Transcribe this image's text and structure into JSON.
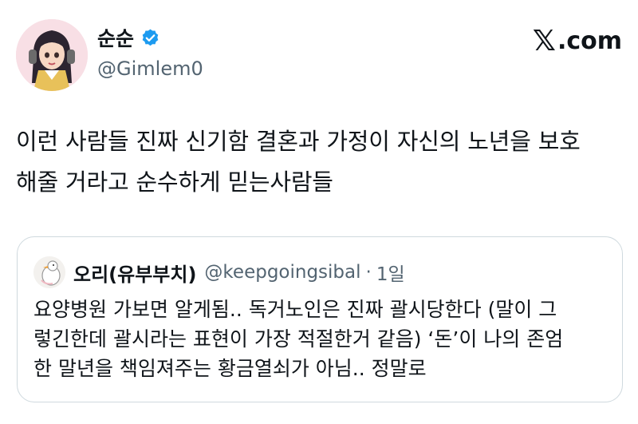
{
  "author": {
    "display_name": "순순",
    "handle": "@Gimlem0",
    "avatar_icon": "anime-girl-avatar",
    "verified_icon": "verified-badge-icon",
    "verified_color": "#1d9bf0"
  },
  "brand": {
    "x_glyph": "𝕏",
    "domain": ".com"
  },
  "tweet": {
    "text_line1": "이런 사람들 진짜 신기함 결혼과 가정이 자신의 노년을 보호",
    "text_line2": "해줄 거라고 순수하게 믿는사람들"
  },
  "quote": {
    "avatar_icon": "duck-avatar",
    "display_name": "오리(유부부치)",
    "handle": "@keepgoingsibal",
    "separator": "·",
    "time": "1일",
    "text_line1": "요양병원 가보면 알게됨.. 독거노인은 진짜 괄시당한다 (말이 그",
    "text_line2": "렇긴한데 괄시라는 표현이 가장 적절한거 같음) ‘돈’이 나의 존엄",
    "text_line3": "한 말년을 책임져주는 황금열쇠가 아님.. 정말로"
  },
  "colors": {
    "text": "#0f1419",
    "secondary": "#536471",
    "border": "#cfd9de"
  }
}
